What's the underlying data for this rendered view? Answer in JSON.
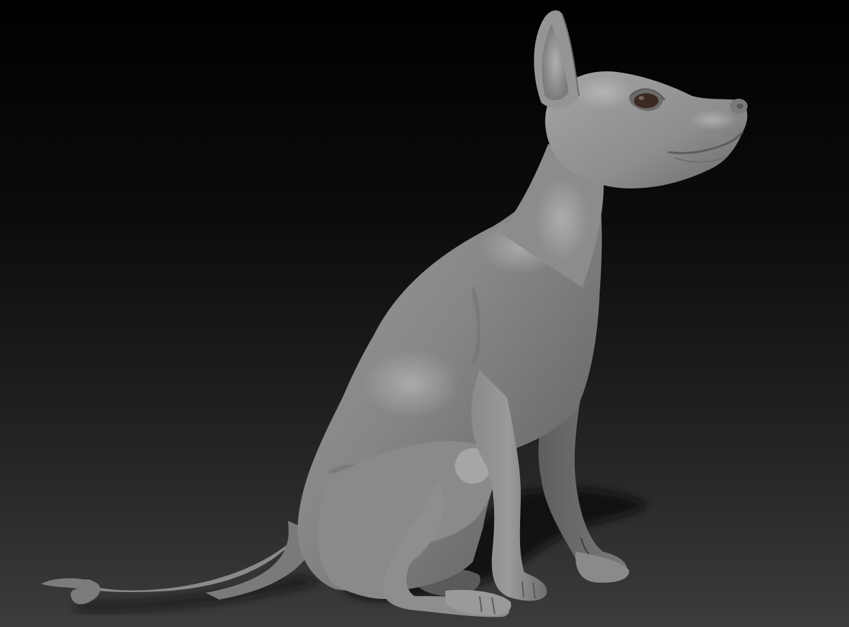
{
  "scene": {
    "subject": "sculpted-dog-model",
    "material": "matte-gray-clay",
    "background_colors": [
      "#000000",
      "#3c3c3c"
    ],
    "clay_color": "#8c8c8c",
    "eye_color": "#3a2a22"
  }
}
